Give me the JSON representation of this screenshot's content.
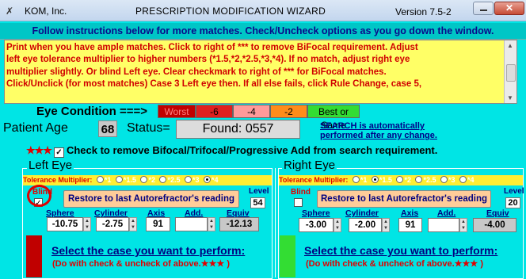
{
  "window": {
    "app_name": "KOM, Inc.",
    "title": "PRESCRIPTION MODIFICATION WIZARD",
    "version": "Version 7.5-2",
    "close_label": "✕"
  },
  "instructions": "Follow instructions below for more matches. Check/Uncheck options as you go down the window.",
  "message": "Print when you have ample matches. Click to right of *** to remove BiFocal requirement. Adjust\nleft eye tolerance multiplier to higher numbers (*1.5,*2,*2.5,*3,*4). If no match, adjust right eye\nmultiplier slightly.  Or blind Left eye. Clear checkmark to right of *** for BiFocal matches.\nClick/Unclick (for most matches) Case 3 Left eye then. If all else fails, click Rule Change, case 5,",
  "eye_condition": {
    "label": "Eye Condition ===>",
    "levels": [
      "Worst",
      "-6",
      "-4",
      "-2",
      "Best or Same"
    ]
  },
  "patient": {
    "age_label": "Patient Age",
    "age": "68",
    "status_label": "Status=",
    "status": "Found:  0557",
    "search_note_line1": "SEARCH is automatically",
    "search_note_line2": "performed after any change."
  },
  "bifocal": {
    "stars": "★★★",
    "checked": true,
    "label": "Check to remove Bifocal/Trifocal/Progressive Add from search requirement."
  },
  "left_eye": {
    "title": "Left Eye",
    "tolerance_label": "Tolerance Multiplier:",
    "tolerance_options": [
      "*1",
      "*1.5",
      "*2",
      "*2.5",
      "*3",
      "*4"
    ],
    "tolerance_selected": "*4",
    "blind_label": "Blind",
    "blind_checked": true,
    "restore_label": "Restore to last Autorefractor's reading",
    "level_label": "Level",
    "level": "54",
    "headers": {
      "sphere": "Sphere",
      "cylinder": "Cylinder",
      "axis": "Axis",
      "add": "Add.",
      "equiv": "Equiv"
    },
    "sphere": "-10.75",
    "cylinder": "-2.75",
    "axis": "91",
    "add": "",
    "equiv": "-12.13",
    "select_case": "Select the case you want to perform:",
    "select_sub": "(Do with check & uncheck of above.",
    "select_sub_stars": "★★★",
    "select_sub_end": ")",
    "bar_color": "#c00000"
  },
  "right_eye": {
    "title": "Right Eye",
    "tolerance_label": "Tolerance Multiplier:",
    "tolerance_options": [
      "*1",
      "*1.5",
      "*2",
      "*2.5",
      "*3",
      "*4"
    ],
    "tolerance_selected": "*1.5",
    "blind_label": "Blind",
    "blind_checked": false,
    "restore_label": "Restore to last Autorefractor's reading",
    "level_label": "Level",
    "level": "20",
    "headers": {
      "sphere": "Sphere",
      "cylinder": "Cylinder",
      "axis": "Axis",
      "add": "Add.",
      "equiv": "Equiv"
    },
    "sphere": "-3.00",
    "cylinder": "-2.00",
    "axis": "91",
    "add": "",
    "equiv": "-4.00",
    "select_case": "Select the case you want to perform:",
    "select_sub": "(Do with check & uncheck of above.",
    "select_sub_stars": "★★★",
    "select_sub_end": ")",
    "bar_color": "#33dd33"
  }
}
